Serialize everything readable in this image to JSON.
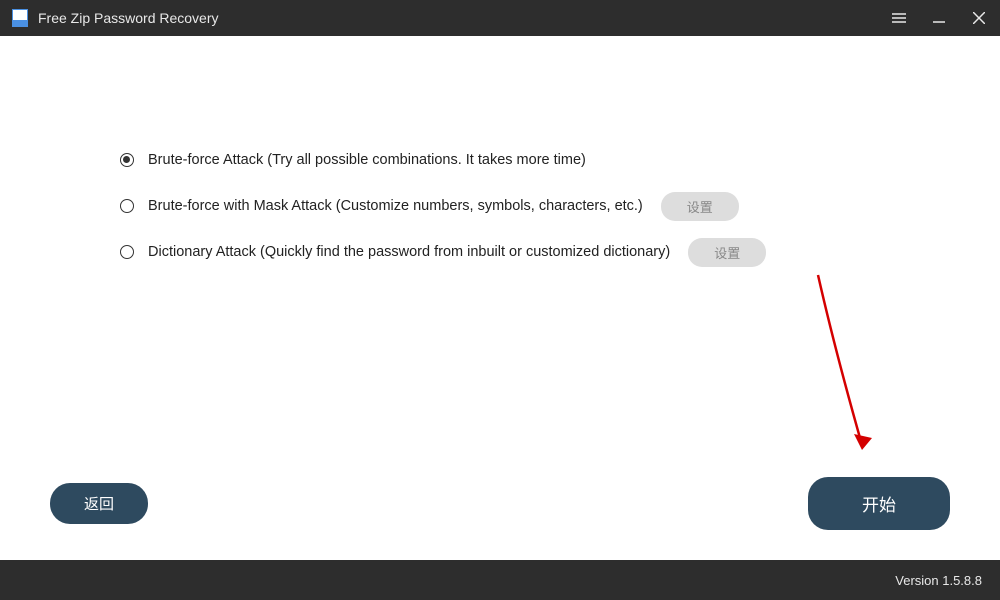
{
  "titlebar": {
    "title": "Free Zip Password Recovery"
  },
  "options": {
    "brute_force": "Brute-force Attack (Try all possible combinations. It takes more time)",
    "mask": "Brute-force with Mask Attack (Customize numbers, symbols, characters, etc.)",
    "dictionary": "Dictionary Attack (Quickly find the password from inbuilt or customized dictionary)",
    "settings_label": "设置"
  },
  "buttons": {
    "back": "返回",
    "start": "开始"
  },
  "footer": {
    "version": "Version 1.5.8.8"
  }
}
